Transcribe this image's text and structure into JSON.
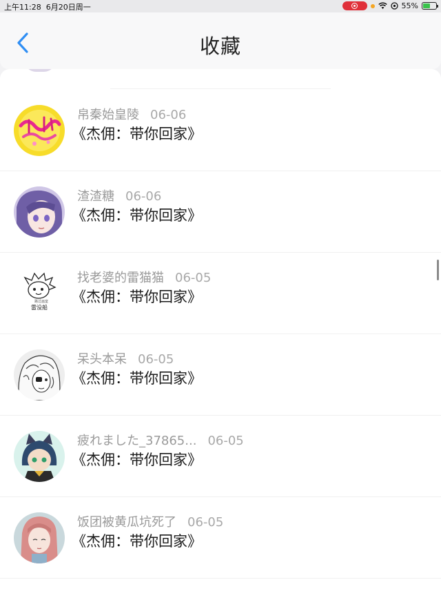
{
  "status_bar": {
    "time": "上午11:28",
    "date": "6月20日周一",
    "battery": "55%",
    "battery_level": 0.55,
    "icons": [
      "screen-record-icon",
      "wifi-icon",
      "location-icon",
      "battery-charging-icon"
    ]
  },
  "nav": {
    "title": "收藏",
    "back_icon": "chevron-left-icon",
    "accent_color": "#2f8ef4"
  },
  "items": [
    {
      "author": "帛秦始皇陵",
      "date": "06-06",
      "title": "《杰佣：带你回家》",
      "avatar": "avatar-yellow-logo"
    },
    {
      "author": "渣渣糖",
      "date": "06-06",
      "title": "《杰佣：带你回家》",
      "avatar": "avatar-purple-hair-girl"
    },
    {
      "author": "找老婆的雷猫猫",
      "date": "06-05",
      "title": "《杰佣：带你回家》",
      "avatar": "avatar-sketch-lion",
      "avatar_text": "雷没船"
    },
    {
      "author": "呆头本呆",
      "date": "06-05",
      "title": "《杰佣：带你回家》",
      "avatar": "avatar-white-hair-sketch"
    },
    {
      "author": "疲れました_37865...",
      "date": "06-05",
      "title": "《杰佣：带你回家》",
      "avatar": "avatar-green-cat-ears"
    },
    {
      "author": "饭团被黄瓜坑死了",
      "date": "06-05",
      "title": "《杰佣：带你回家》",
      "avatar": "avatar-pink-hair-girl"
    }
  ]
}
